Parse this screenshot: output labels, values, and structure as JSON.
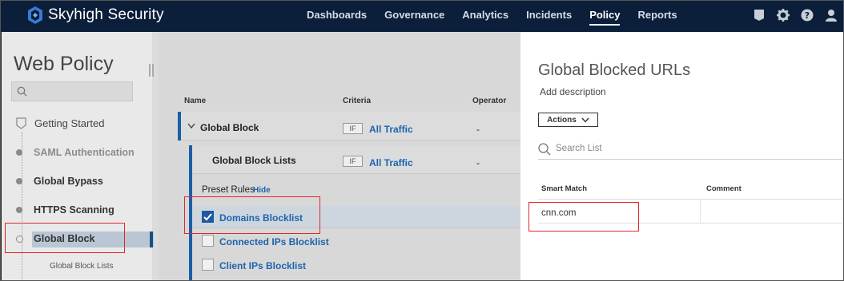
{
  "app": {
    "name": "Skyhigh Security"
  },
  "nav": {
    "items": [
      "Dashboards",
      "Governance",
      "Analytics",
      "Incidents",
      "Policy",
      "Reports"
    ],
    "active": "Policy"
  },
  "top_icons": [
    "notification-icon",
    "gear-icon",
    "help-icon",
    "user-icon"
  ],
  "sidebar": {
    "title": "Web Policy",
    "search_placeholder": "",
    "items": [
      {
        "label": "Getting Started"
      },
      {
        "label": "SAML Authentication"
      },
      {
        "label": "Global Bypass"
      },
      {
        "label": "HTTPS Scanning"
      },
      {
        "label": "Global Block"
      },
      {
        "label": "Global Block Lists"
      }
    ]
  },
  "table": {
    "columns": [
      "Name",
      "Criteria",
      "Operator"
    ],
    "rows": [
      {
        "name": "Global Block",
        "if_tag": "IF",
        "criteria": "All Traffic",
        "operator": "-"
      },
      {
        "name": "Global Block Lists",
        "if_tag": "IF",
        "criteria": "All Traffic",
        "operator": "-"
      }
    ],
    "preset_rules": {
      "label": "Preset Rules",
      "toggle": "Hide"
    },
    "rules": [
      {
        "label": "Domains Blocklist",
        "checked": true
      },
      {
        "label": "Connected IPs Blocklist",
        "checked": false
      },
      {
        "label": "Client IPs Blocklist",
        "checked": false
      }
    ]
  },
  "detail": {
    "title": "Global Blocked URLs",
    "description": "Add description",
    "actions_label": "Actions",
    "search_placeholder": "Search List",
    "columns": [
      "Smart Match",
      "Comment"
    ],
    "entries": [
      {
        "match": "cnn.com",
        "comment": ""
      }
    ]
  },
  "colors": {
    "topbar": "#0b1f3a",
    "link": "#1d64ae",
    "highlight": "#e0262b",
    "accent": "#1a5ea8"
  }
}
